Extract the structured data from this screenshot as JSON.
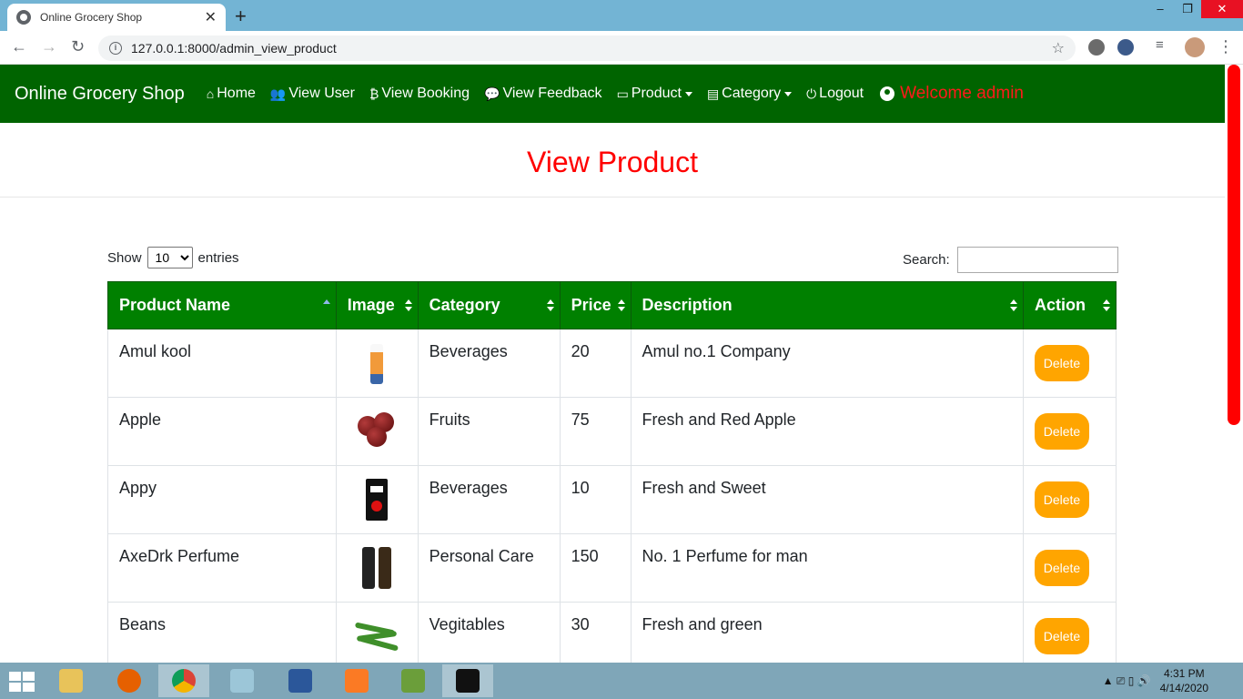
{
  "browser": {
    "tab_title": "Online Grocery Shop",
    "url": "127.0.0.1:8000/admin_view_product"
  },
  "navbar": {
    "brand": "Online Grocery Shop",
    "items": [
      {
        "label": "Home",
        "icon": "home-icon"
      },
      {
        "label": "View User",
        "icon": "users-icon"
      },
      {
        "label": "View Booking",
        "icon": "bitcoin-icon"
      },
      {
        "label": "View Feedback",
        "icon": "comment-icon"
      },
      {
        "label": "Product",
        "icon": "box-icon",
        "dropdown": true
      },
      {
        "label": "Category",
        "icon": "list-icon",
        "dropdown": true
      },
      {
        "label": "Logout",
        "icon": "power-icon"
      }
    ],
    "welcome": "Welcome admin"
  },
  "page": {
    "title": "View Product"
  },
  "table_controls": {
    "show_label": "Show",
    "entries_value": "10",
    "entries_label": "entries",
    "search_label": "Search:",
    "search_value": ""
  },
  "table": {
    "columns": [
      "Product Name",
      "Image",
      "Category",
      "Price",
      "Description",
      "Action"
    ],
    "rows": [
      {
        "name": "Amul kool",
        "image": "bottle",
        "category": "Beverages",
        "price": "20",
        "description": "Amul no.1 Company",
        "action": "Delete"
      },
      {
        "name": "Apple",
        "image": "apples",
        "category": "Fruits",
        "price": "75",
        "description": "Fresh and Red Apple",
        "action": "Delete"
      },
      {
        "name": "Appy",
        "image": "appy-box",
        "category": "Beverages",
        "price": "10",
        "description": "Fresh and Sweet",
        "action": "Delete"
      },
      {
        "name": "AxeDrk Perfume",
        "image": "perfume",
        "category": "Personal Care",
        "price": "150",
        "description": "No. 1 Perfume for man",
        "action": "Delete"
      },
      {
        "name": "Beans",
        "image": "beans",
        "category": "Vegitables",
        "price": "30",
        "description": "Fresh and green",
        "action": "Delete"
      }
    ]
  },
  "taskbar": {
    "time": "4:31 PM",
    "date": "4/14/2020"
  },
  "colors": {
    "navbar": "#006400",
    "table_header": "#008000",
    "title": "#ff0000",
    "delete_button": "#ffa500"
  }
}
